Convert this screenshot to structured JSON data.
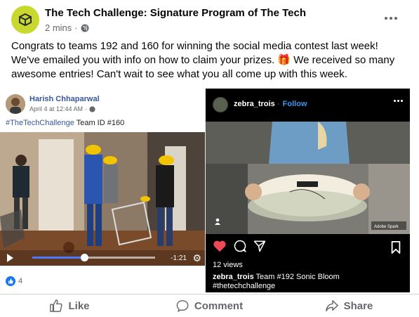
{
  "post": {
    "page_name": "The Tech Challenge: Signature Program of The Tech",
    "time": "2 mins",
    "separator": "·",
    "text": "Congrats to teams 192 and 160 for winning the social media contest last week! We've emailed you with info on how to claim your prizes. 🎁 We received so many awesome entries! Can't wait to see what you all come up with this week."
  },
  "fb_embed": {
    "author": "Harish Chhaparwal",
    "date": "April 4 at 12:44 AM",
    "separator": "·",
    "hashtag": "#TheTechChallenge",
    "caption_rest": " Team ID #160",
    "video_time": "-1:21",
    "video_progress": 0.42,
    "reaction_count": "4"
  },
  "ig_embed": {
    "user": "zebra_trois",
    "dot": "·",
    "follow": "Follow",
    "views": "12 views",
    "caption_user": "zebra_trois",
    "caption_text": " Team #192 Sonic Bloom",
    "caption_tag": "#thetechchallenge",
    "watermark": "Adobe Spark"
  },
  "actions": {
    "like": "Like",
    "comment": "Comment",
    "share": "Share"
  },
  "colors": {
    "accent": "#1877f2",
    "ig_link": "#3897f0",
    "heart": "#ed4956",
    "brand_avatar": "#c9d82e"
  },
  "icons": [
    "globe-icon",
    "more-icon",
    "play-icon",
    "gear-icon",
    "like-icon",
    "heart-icon",
    "comment-bubble-icon",
    "send-icon",
    "bookmark-icon",
    "comment-icon",
    "share-icon",
    "camera-icon"
  ]
}
